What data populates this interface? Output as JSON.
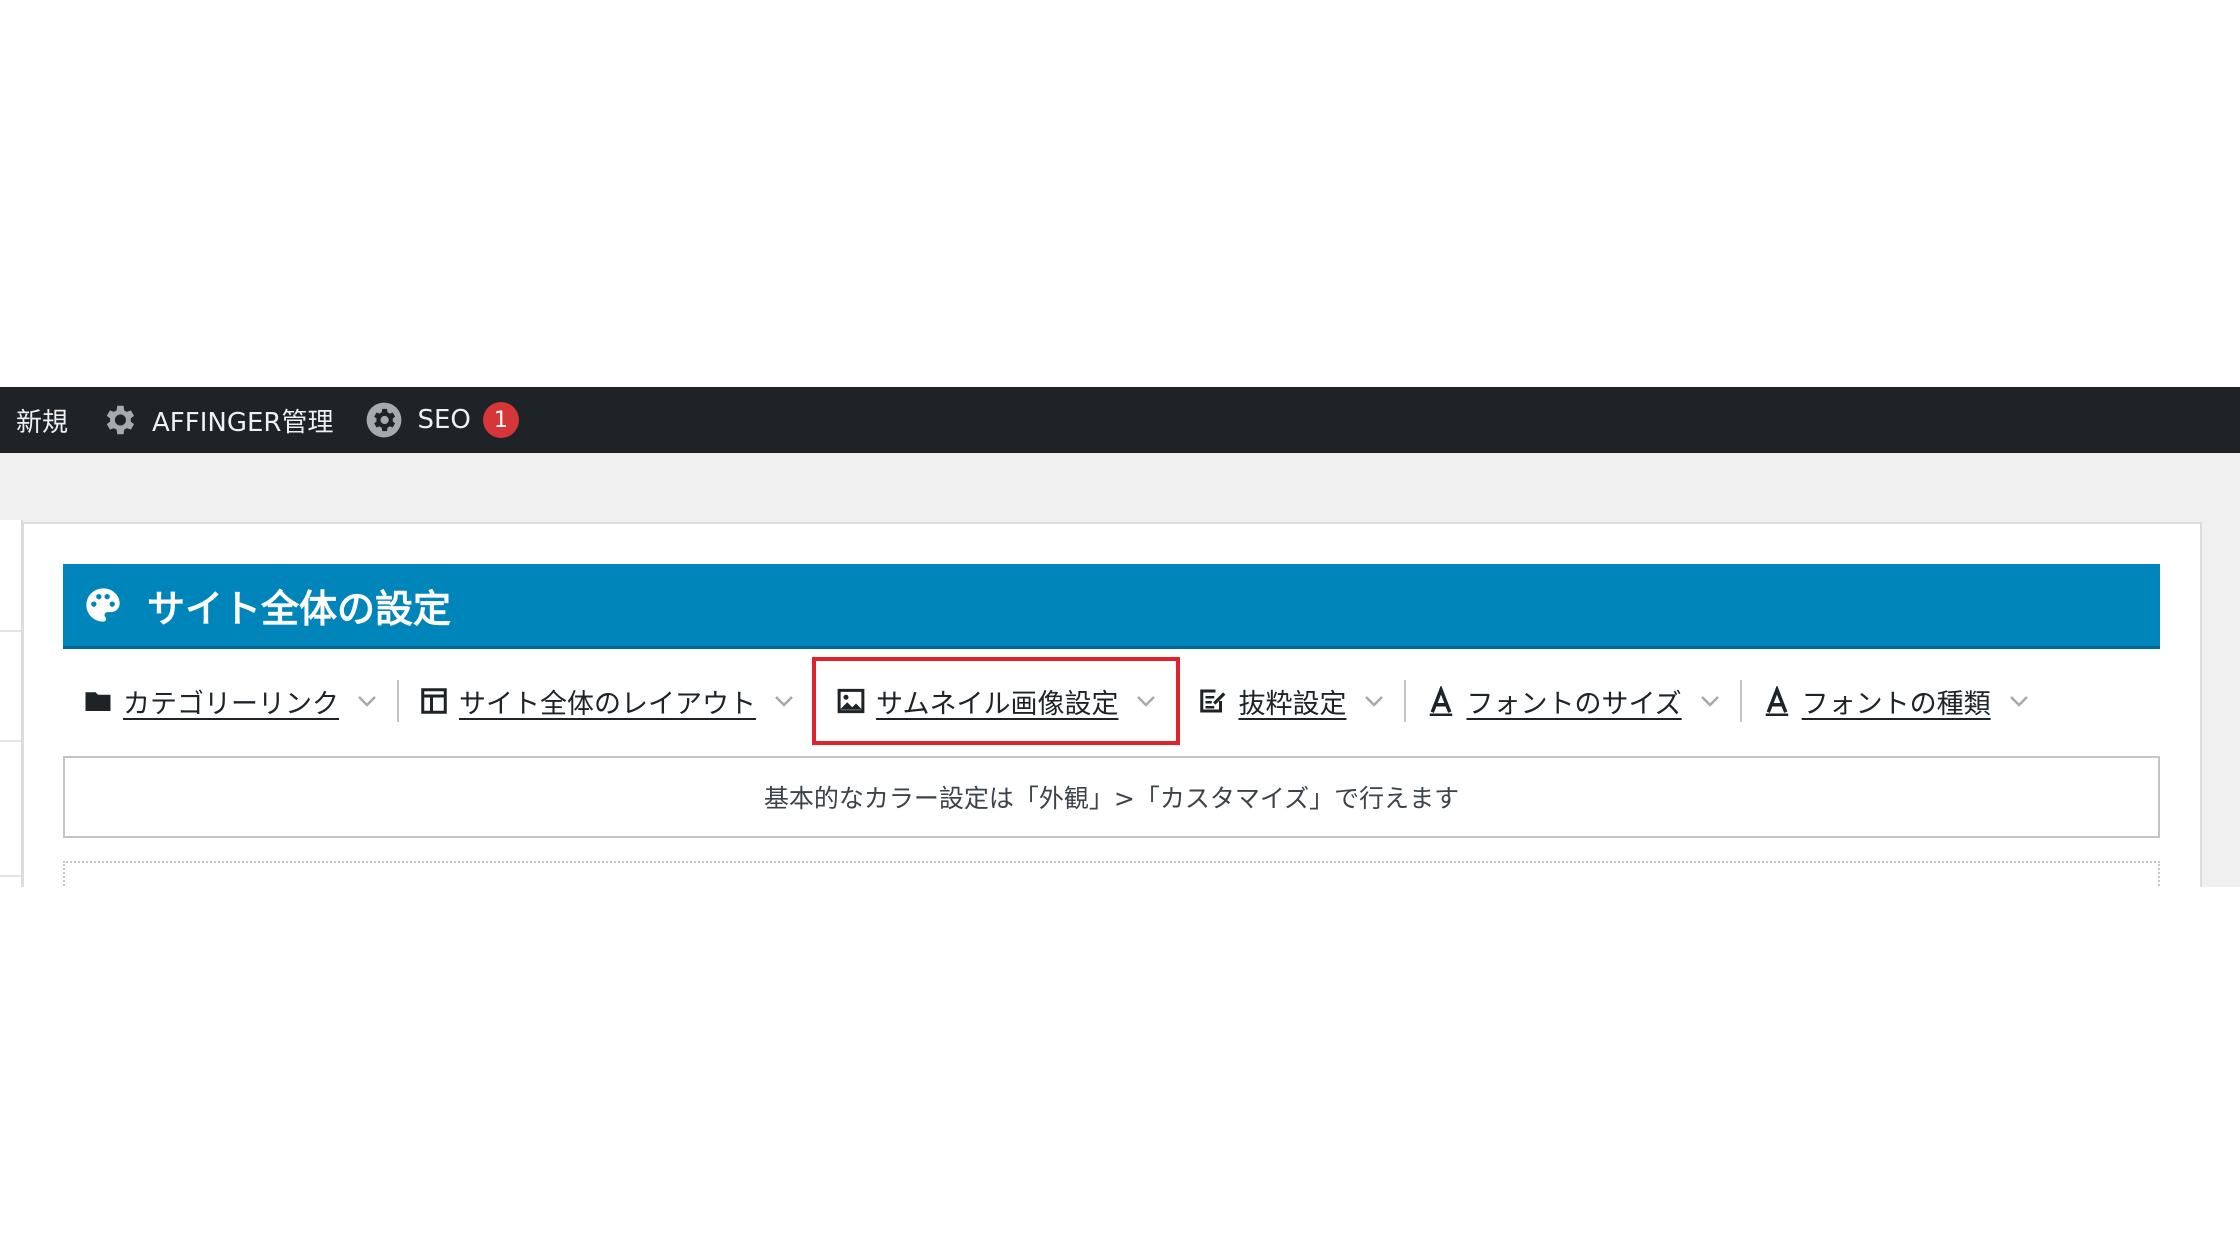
{
  "adminbar": {
    "items": [
      {
        "label": "新規",
        "icon": ""
      },
      {
        "label": "AFFINGER管理",
        "icon": "gear-icon"
      },
      {
        "label": "SEO",
        "icon": "seo-gear-icon",
        "badge": "1"
      }
    ]
  },
  "panel": {
    "title": "サイト全体の設定",
    "title_icon": "palette-icon",
    "accent_color": "#0085ba",
    "tabs": [
      {
        "label": "カテゴリーリンク",
        "icon": "folder-icon"
      },
      {
        "label": "サイト全体のレイアウト",
        "icon": "layout-icon"
      },
      {
        "label": "サムネイル画像設定",
        "icon": "image-icon",
        "highlighted": true
      },
      {
        "label": "抜粋設定",
        "icon": "excerpt-icon"
      },
      {
        "label": "フォントのサイズ",
        "icon": "font-icon"
      },
      {
        "label": "フォントの種類",
        "icon": "font-icon"
      }
    ],
    "notice": "基本的なカラー設定は「外観」>「カスタマイズ」で行えます",
    "highlight_color": "#e0222b"
  }
}
